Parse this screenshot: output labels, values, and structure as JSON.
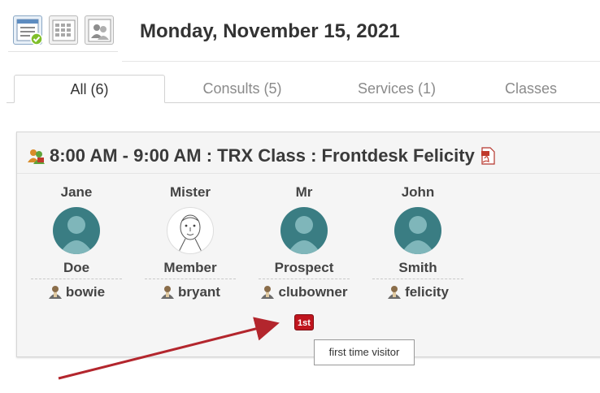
{
  "header": {
    "title": "Monday, November 15, 2021",
    "view_icons": [
      "list-view-icon",
      "grid-view-icon",
      "people-view-icon"
    ]
  },
  "tabs": [
    {
      "label": "All (6)",
      "active": true
    },
    {
      "label": "Consults (5)",
      "active": false
    },
    {
      "label": "Services (1)",
      "active": false
    },
    {
      "label": "Classes",
      "active": false
    }
  ],
  "session": {
    "title": "8:00 AM - 9:00 AM : TRX Class : Frontdesk Felicity",
    "attendees": [
      {
        "first": "Jane",
        "last": "Doe",
        "username": "bowie",
        "avatar": "silhouette"
      },
      {
        "first": "Mister",
        "last": "Member",
        "username": "bryant",
        "avatar": "sketch"
      },
      {
        "first": "Mr",
        "last": "Prospect",
        "username": "clubowner",
        "avatar": "silhouette"
      },
      {
        "first": "John",
        "last": "Smith",
        "username": "felicity",
        "avatar": "silhouette"
      }
    ]
  },
  "badge": {
    "label": "1st",
    "color": "#c0151e"
  },
  "tooltip": {
    "text": "first time visitor"
  },
  "colors": {
    "avatar": "#3a7d83",
    "arrow": "#b3262d"
  }
}
